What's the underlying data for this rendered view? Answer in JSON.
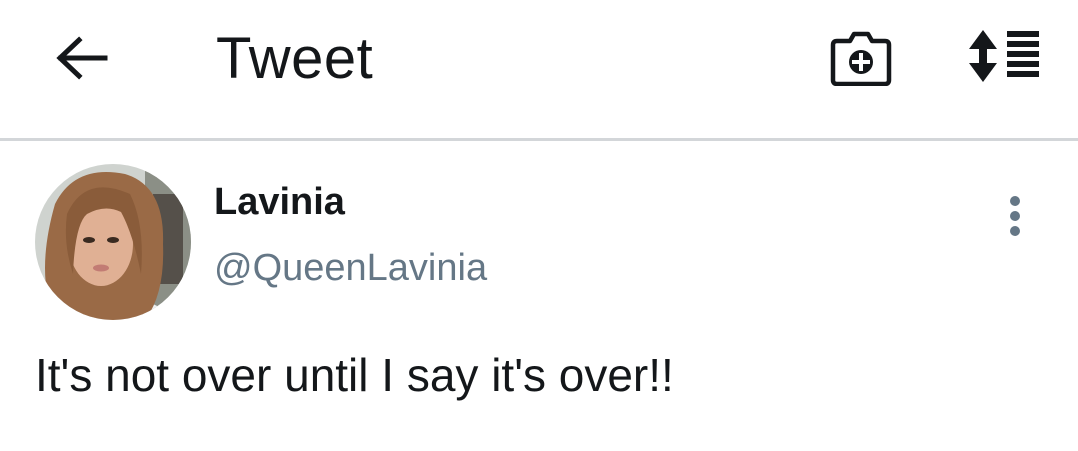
{
  "header": {
    "title": "Tweet",
    "back_icon": "arrow-left-icon",
    "camera_icon": "camera-add-icon",
    "sort_icon": "sort-list-icon"
  },
  "tweet": {
    "author_name": "Lavinia",
    "author_handle": "@QueenLavinia",
    "text": "It's not over until I say it's over!!",
    "more_icon": "more-vertical-icon"
  },
  "colors": {
    "text_primary": "#14171a",
    "text_secondary": "#657786",
    "divider": "#d3d6d9",
    "background": "#ffffff"
  }
}
